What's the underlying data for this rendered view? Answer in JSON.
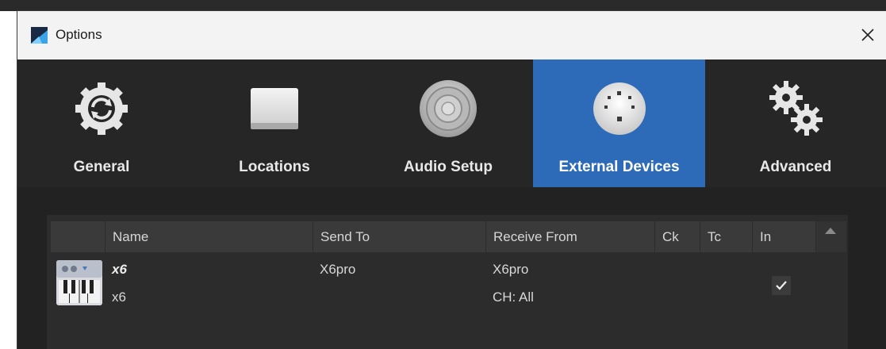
{
  "window": {
    "title": "Options"
  },
  "tabs": [
    {
      "label": "General",
      "icon": "gear-sync-icon",
      "active": false
    },
    {
      "label": "Locations",
      "icon": "drive-icon",
      "active": false
    },
    {
      "label": "Audio Setup",
      "icon": "speaker-icon",
      "active": false
    },
    {
      "label": "External Devices",
      "icon": "midi-port-icon",
      "active": true
    },
    {
      "label": "Advanced",
      "icon": "gears-icon",
      "active": false
    }
  ],
  "table": {
    "columns": [
      "Name",
      "Send To",
      "Receive From",
      "Ck",
      "Tc",
      "In"
    ],
    "rows": [
      {
        "name": "x6",
        "model": "x6",
        "send_to": "X6pro",
        "receive_from": "X6pro",
        "channel": "CH: All",
        "ck": false,
        "tc": false,
        "in": true
      }
    ]
  },
  "colors": {
    "accent": "#2d6bb8",
    "toolbar_bg": "#262626",
    "content_bg": "#222222",
    "header_bg": "#3a3a3a"
  }
}
